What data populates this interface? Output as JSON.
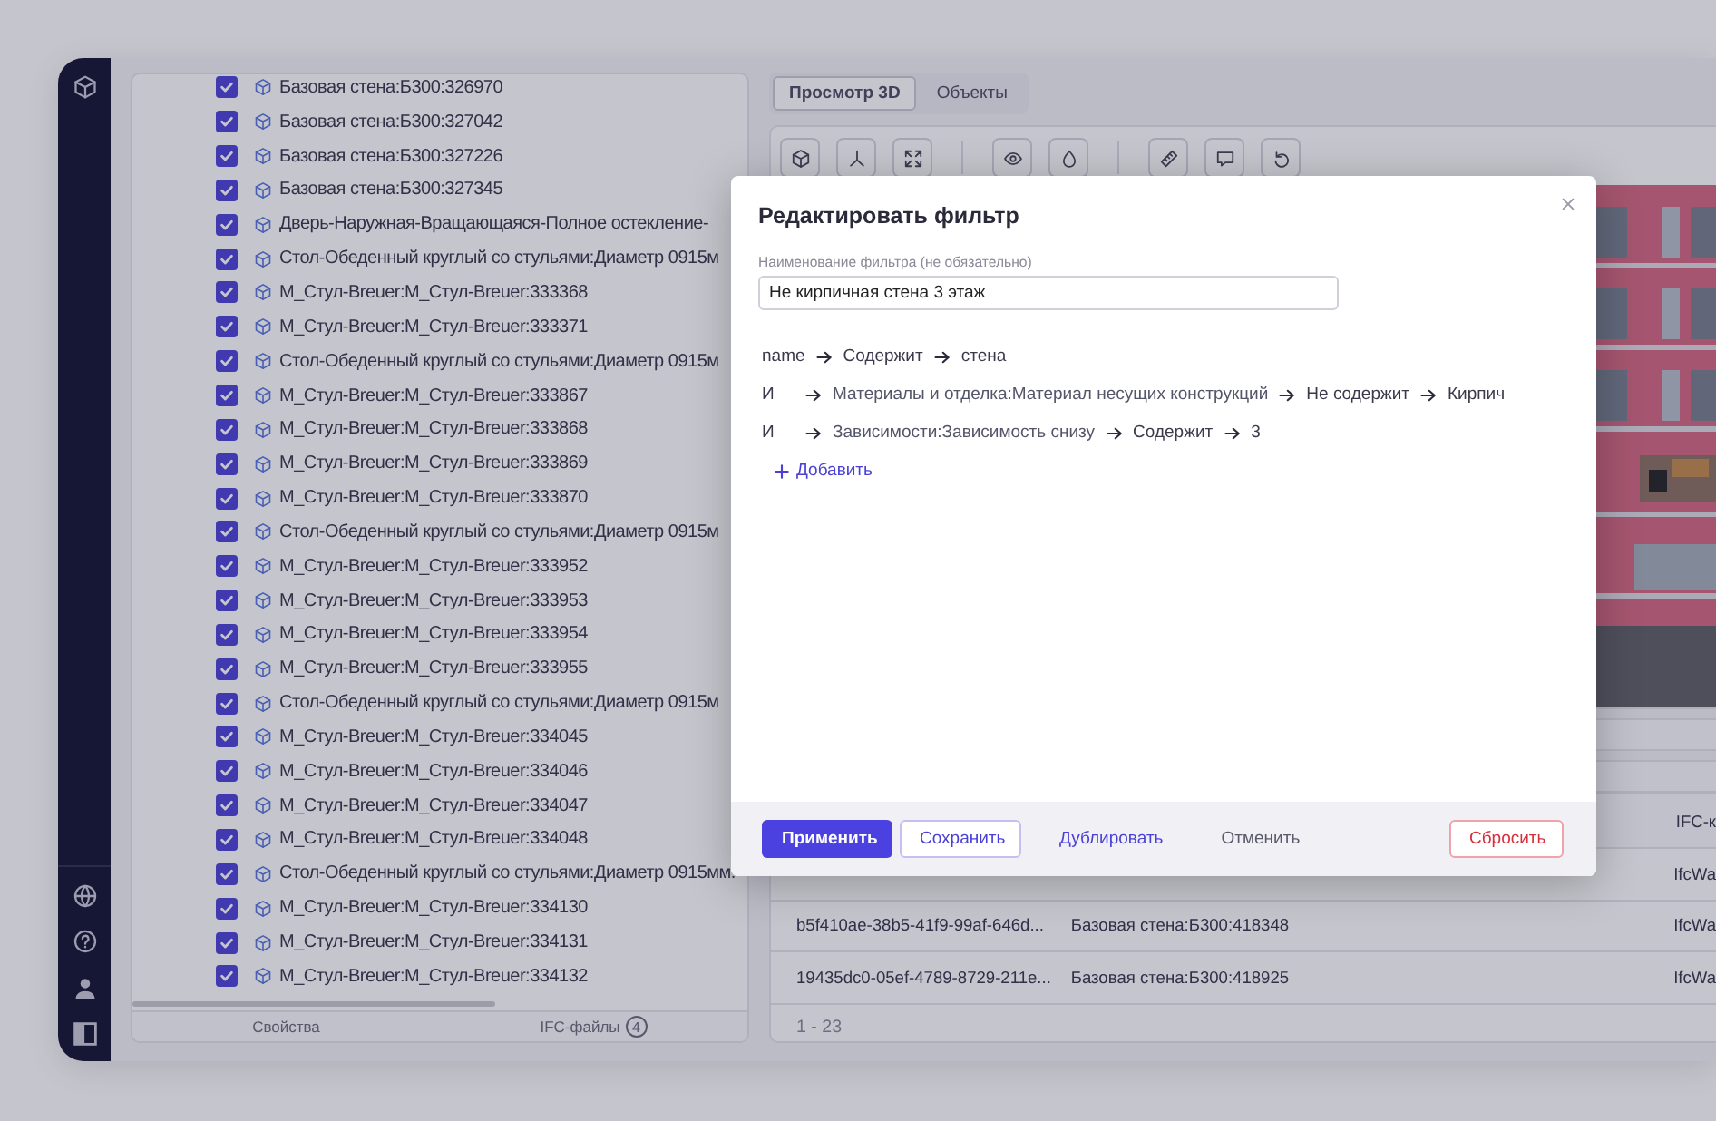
{
  "tree_items": [
    {
      "label": "Базовая стена:Б300:326970",
      "checked": true
    },
    {
      "label": "Базовая стена:Б300:327042",
      "checked": true
    },
    {
      "label": "Базовая стена:Б300:327226",
      "checked": true
    },
    {
      "label": "Базовая стена:Б300:327345",
      "checked": true
    },
    {
      "label": "Дверь-Наружная-Вращающаяся-Полное остекление-",
      "checked": true
    },
    {
      "label": "Стол-Обеденный круглый со стульями:Диаметр 0915м",
      "checked": true
    },
    {
      "label": "М_Стул-Breuer:М_Стул-Breuer:333368",
      "checked": true
    },
    {
      "label": "М_Стул-Breuer:М_Стул-Breuer:333371",
      "checked": true
    },
    {
      "label": "Стол-Обеденный круглый со стульями:Диаметр 0915м",
      "checked": true
    },
    {
      "label": "М_Стул-Breuer:М_Стул-Breuer:333867",
      "checked": true
    },
    {
      "label": "М_Стул-Breuer:М_Стул-Breuer:333868",
      "checked": true
    },
    {
      "label": "М_Стул-Breuer:М_Стул-Breuer:333869",
      "checked": true
    },
    {
      "label": "М_Стул-Breuer:М_Стул-Breuer:333870",
      "checked": true
    },
    {
      "label": "Стол-Обеденный круглый со стульями:Диаметр 0915м",
      "checked": true
    },
    {
      "label": "М_Стул-Breuer:М_Стул-Breuer:333952",
      "checked": true
    },
    {
      "label": "М_Стул-Breuer:М_Стул-Breuer:333953",
      "checked": true
    },
    {
      "label": "М_Стул-Breuer:М_Стул-Breuer:333954",
      "checked": true
    },
    {
      "label": "М_Стул-Breuer:М_Стул-Breuer:333955",
      "checked": true
    },
    {
      "label": "Стол-Обеденный круглый со стульями:Диаметр 0915м",
      "checked": true
    },
    {
      "label": "М_Стул-Breuer:М_Стул-Breuer:334045",
      "checked": true
    },
    {
      "label": "М_Стул-Breuer:М_Стул-Breuer:334046",
      "checked": true
    },
    {
      "label": "М_Стул-Breuer:М_Стул-Breuer:334047",
      "checked": true
    },
    {
      "label": "М_Стул-Breuer:М_Стул-Breuer:334048",
      "checked": true
    },
    {
      "label": "Стол-Обеденный круглый со стульями:Диаметр 0915мм:",
      "checked": true
    },
    {
      "label": "М_Стул-Breuer:М_Стул-Breuer:334130",
      "checked": true
    },
    {
      "label": "М_Стул-Breuer:М_Стул-Breuer:334131",
      "checked": true
    },
    {
      "label": "М_Стул-Breuer:М_Стул-Breuer:334132",
      "checked": true
    }
  ],
  "left_tabs": [
    {
      "label": "Свойства",
      "selected": false
    },
    {
      "label": "IFC-файлы",
      "badge": "4",
      "selected": false
    }
  ],
  "view_tabs": [
    {
      "label": "Просмотр 3D",
      "selected": true
    },
    {
      "label": "Объекты",
      "selected": false
    }
  ],
  "table": {
    "header": {
      "column_3": "IFC-к"
    },
    "rows": [
      {
        "column_3": "IfcWa"
      },
      {
        "column_1": "b5f410ae-38b5-41f9-99af-646d...",
        "column_2": "Базовая стена:Б300:418348",
        "column_3": "IfcWa"
      },
      {
        "column_1": "19435dc0-05ef-4789-8729-211e...",
        "column_2": "Базовая стена:Б300:418925",
        "column_3": "IfcWa"
      }
    ],
    "footer": "1 - 23"
  },
  "dialog": {
    "title": "Редактировать фильтр",
    "name_field": {
      "label": "Наименование фильтра (не обязательно)",
      "value": "Не кирпичная стена 3 этаж"
    },
    "rules": [
      {
        "field": "name",
        "operator": "Содержит",
        "value": "стена"
      },
      {
        "connector": "И",
        "field": "Материалы и отделка:Материал несущих конструкций",
        "operator": "Не содержит",
        "value": "Кирпич"
      },
      {
        "connector": "И",
        "field": "Зависимости:Зависимость снизу",
        "operator": "Содержит",
        "value": "3"
      }
    ],
    "add_link": "Добавить",
    "buttons": [
      {
        "label": "Применить",
        "kind": "primary"
      },
      {
        "label": "Сохранить",
        "kind": "outline"
      },
      {
        "label": "Дублировать",
        "kind": "link"
      },
      {
        "label": "Отменить",
        "kind": "plain"
      },
      {
        "label": "Сбросить",
        "kind": "danger"
      }
    ]
  }
}
